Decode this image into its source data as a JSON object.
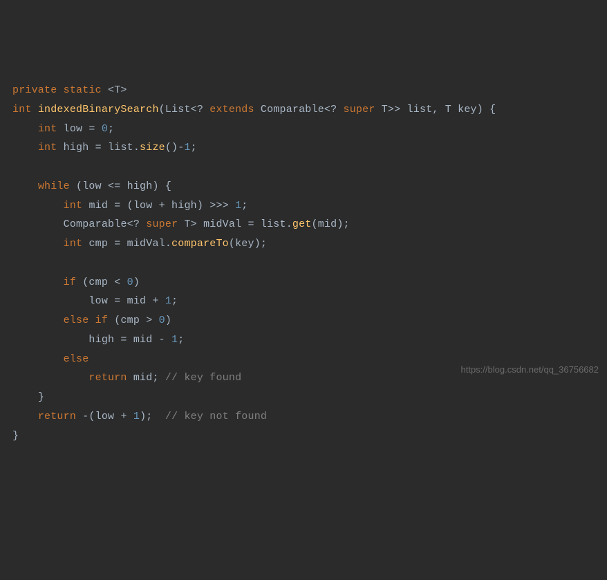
{
  "code": {
    "l1": {
      "kw1": "private static ",
      "generic": "<T>"
    },
    "l2": {
      "kw1": "int ",
      "fn": "indexedBinarySearch",
      "p1": "(List<? ",
      "kw2": "extends ",
      "p2": "Comparable<? ",
      "kw3": "super ",
      "p3": "T>> list, T key) {"
    },
    "l3": {
      "indent": "    ",
      "kw1": "int ",
      "p1": "low = ",
      "n1": "0",
      "p2": ";"
    },
    "l4": {
      "indent": "    ",
      "kw1": "int ",
      "p1": "high = list.",
      "fn": "size",
      "p2": "()-",
      "n1": "1",
      "p3": ";"
    },
    "l5": {
      "blank": ""
    },
    "l6": {
      "indent": "    ",
      "kw1": "while ",
      "p1": "(low <= high) {"
    },
    "l7": {
      "indent": "        ",
      "kw1": "int ",
      "p1": "mid = (low + high) >>> ",
      "n1": "1",
      "p2": ";"
    },
    "l8": {
      "indent": "        ",
      "p1": "Comparable<? ",
      "kw1": "super ",
      "p2": "T> midVal = list.",
      "fn": "get",
      "p3": "(mid);"
    },
    "l9": {
      "indent": "        ",
      "kw1": "int ",
      "p1": "cmp = midVal.",
      "fn": "compareTo",
      "p2": "(key);"
    },
    "l10": {
      "blank": ""
    },
    "l11": {
      "indent": "        ",
      "kw1": "if ",
      "p1": "(cmp < ",
      "n1": "0",
      "p2": ")"
    },
    "l12": {
      "indent": "            ",
      "p1": "low = mid + ",
      "n1": "1",
      "p2": ";"
    },
    "l13": {
      "indent": "        ",
      "kw1": "else if ",
      "p1": "(cmp > ",
      "n1": "0",
      "p2": ")"
    },
    "l14": {
      "indent": "            ",
      "p1": "high = mid - ",
      "n1": "1",
      "p2": ";"
    },
    "l15": {
      "indent": "        ",
      "kw1": "else"
    },
    "l16": {
      "indent": "            ",
      "kw1": "return ",
      "p1": "mid; ",
      "cmt": "// key found"
    },
    "l17": {
      "indent": "    ",
      "p1": "}"
    },
    "l18": {
      "indent": "    ",
      "kw1": "return ",
      "p1": "-(low + ",
      "n1": "1",
      "p2": ");  ",
      "cmt": "// key not found"
    },
    "l19": {
      "p1": "}"
    }
  },
  "watermark": "https://blog.csdn.net/qq_36756682"
}
